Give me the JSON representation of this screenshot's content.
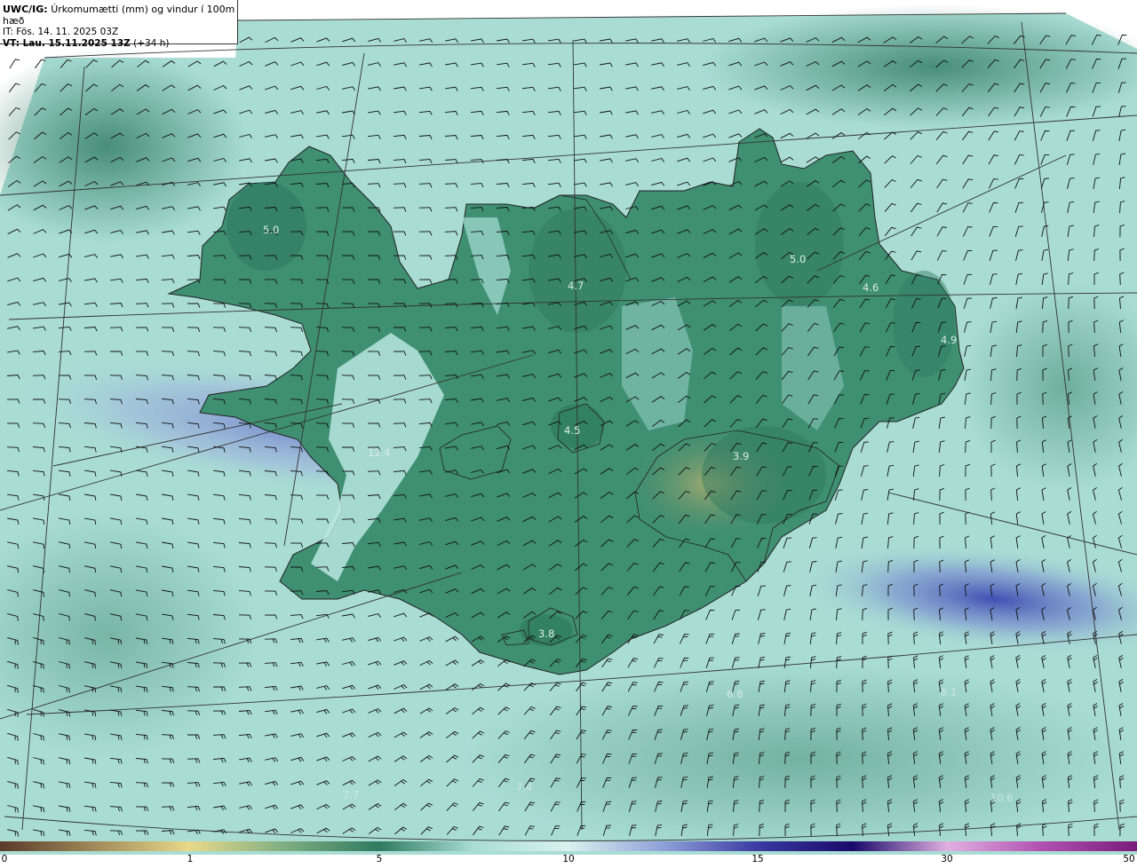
{
  "header": {
    "model": "UWC/IG:",
    "title": "Úrkomumætti (mm) og vindur í 100m hæð",
    "init_time": "IT: Fös. 14. 11. 2025 03Z",
    "valid_label": "VT: Lau. 15.11.2025 13Z",
    "valid_offset": "(+34 h)"
  },
  "colors": {
    "sea_base": "#a9ddd4",
    "land_base": "#3d8f72",
    "land_dark": "#2f7a60",
    "high_value": "#6b7cc7",
    "coast": "#222222",
    "grid": "#333333",
    "barb": "#111111"
  },
  "value_labels": [
    "5.0",
    "4.7",
    "5.0",
    "4.6",
    "4.9",
    "4.5",
    "3.9",
    "3.8",
    "12.4",
    "6.8",
    "8.1",
    "7.4",
    "7.7",
    "10.6"
  ],
  "colorbar": {
    "ticks": [
      "0",
      "1",
      "5",
      "10",
      "15",
      "30",
      "50"
    ],
    "stops": [
      "#5a3a2a",
      "#a08a5a",
      "#e8d98a",
      "#7fae82",
      "#2f7a60",
      "#a9ddd4",
      "#d8f2ee",
      "#8fa0d8",
      "#3a3aa0",
      "#1a0a6a",
      "#e0b0e0",
      "#b050b0",
      "#7a1a7a"
    ]
  }
}
